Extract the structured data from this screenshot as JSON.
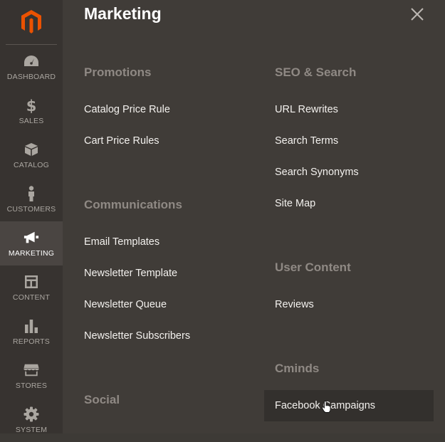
{
  "panel": {
    "title": "Marketing",
    "close_icon": "close-icon"
  },
  "sidebar": {
    "logo_icon": "magento-logo",
    "items": [
      {
        "label": "DASHBOARD",
        "icon": "dashboard-icon"
      },
      {
        "label": "SALES",
        "icon": "dollar-icon"
      },
      {
        "label": "CATALOG",
        "icon": "box-icon"
      },
      {
        "label": "CUSTOMERS",
        "icon": "person-icon"
      },
      {
        "label": "MARKETING",
        "icon": "megaphone-icon",
        "active": true
      },
      {
        "label": "CONTENT",
        "icon": "layout-icon"
      },
      {
        "label": "REPORTS",
        "icon": "bar-chart-icon"
      },
      {
        "label": "STORES",
        "icon": "store-icon"
      },
      {
        "label": "SYSTEM",
        "icon": "gear-icon"
      }
    ]
  },
  "sections": {
    "promotions": {
      "title": "Promotions",
      "items": [
        "Catalog Price Rule",
        "Cart Price Rules"
      ]
    },
    "communications": {
      "title": "Communications",
      "items": [
        "Email Templates",
        "Newsletter Template",
        "Newsletter Queue",
        "Newsletter Subscribers"
      ]
    },
    "social": {
      "title": "Social"
    },
    "seo_search": {
      "title": "SEO & Search",
      "items": [
        "URL Rewrites",
        "Search Terms",
        "Search Synonyms",
        "Site Map"
      ]
    },
    "user_content": {
      "title": "User Content",
      "items": [
        "Reviews"
      ]
    },
    "cminds": {
      "title": "Cminds",
      "items": [
        "Facebook Campaigns"
      ]
    }
  },
  "colors": {
    "accent": "#eb5202",
    "panel_bg": "#403c38",
    "sidebar_bg": "#373330",
    "section_title": "#8f8984"
  }
}
